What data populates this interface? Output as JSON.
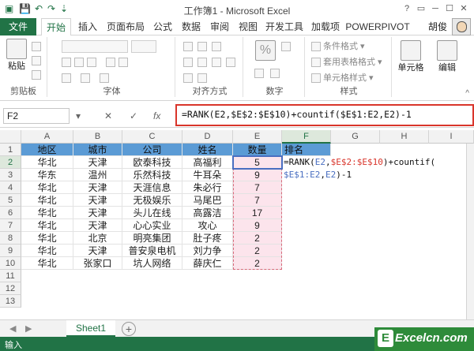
{
  "window": {
    "title": "工作簿1 - Microsoft Excel",
    "help": "?",
    "user": "胡俊"
  },
  "tabs": [
    "文件",
    "开始",
    "插入",
    "页面布局",
    "公式",
    "数据",
    "审阅",
    "视图",
    "开发工具",
    "加载项",
    "POWERPIVOT"
  ],
  "ribbon": {
    "paste_label": "粘贴",
    "groups": {
      "clipboard": "剪贴板",
      "font": "字体",
      "alignment": "对齐方式",
      "number": "数字",
      "styles": "样式",
      "cells_btn": "单元格",
      "edit_btn": "编辑"
    },
    "percent": "%",
    "style_items": [
      "条件格式",
      "套用表格格式",
      "单元格样式"
    ]
  },
  "formula_bar": {
    "cell_ref": "F2",
    "cancel": "✕",
    "enter": "✓",
    "fx": "fx",
    "formula": "=RANK(E2,$E$2:$E$10)+countif($E$1:E2,E2)-1"
  },
  "grid": {
    "columns": [
      "A",
      "B",
      "C",
      "D",
      "E",
      "F",
      "G",
      "H",
      "I"
    ],
    "rows": [
      "1",
      "2",
      "3",
      "4",
      "5",
      "6",
      "7",
      "8",
      "9",
      "10",
      "11",
      "12",
      "13"
    ],
    "headers": [
      "地区",
      "城市",
      "公司",
      "姓名",
      "数量",
      "排名"
    ],
    "data": [
      [
        "华北",
        "天津",
        "欧泰科技",
        "高福利",
        "5"
      ],
      [
        "华东",
        "温州",
        "乐然科技",
        "牛耳朵",
        "9"
      ],
      [
        "华北",
        "天津",
        "天涯信息",
        "朱必行",
        "7"
      ],
      [
        "华北",
        "天津",
        "无极娱乐",
        "马尾巴",
        "7"
      ],
      [
        "华北",
        "天津",
        "头儿在线",
        "高露洁",
        "17"
      ],
      [
        "华北",
        "天津",
        "心心实业",
        "攻心",
        "9"
      ],
      [
        "华北",
        "北京",
        "明亮集团",
        "肚子疼",
        "2"
      ],
      [
        "华北",
        "天津",
        "普安泉电机",
        "刘力争",
        "2"
      ],
      [
        "华北",
        "张家口",
        "坑人网络",
        "薛庆仁",
        "2"
      ]
    ],
    "cell_formula": {
      "line1_a": "=RANK(",
      "line1_b": "E2",
      "line1_c": ",",
      "line1_d": "$E$2:$E$10",
      "line1_e": ")+countif(",
      "line2_a": "$E$1:E2",
      "line2_b": ",",
      "line2_c": "E2",
      "line2_d": ")-1"
    }
  },
  "sheets": {
    "active": "Sheet1",
    "add": "+"
  },
  "status": {
    "mode": "输入"
  },
  "watermark": {
    "badge": "E",
    "text": "Excelcn.com"
  },
  "colors": {
    "excel_green": "#217346",
    "header_blue": "#5b9bd5",
    "highlight_red": "#d9352b",
    "ref_blue": "#4a6fc1"
  }
}
